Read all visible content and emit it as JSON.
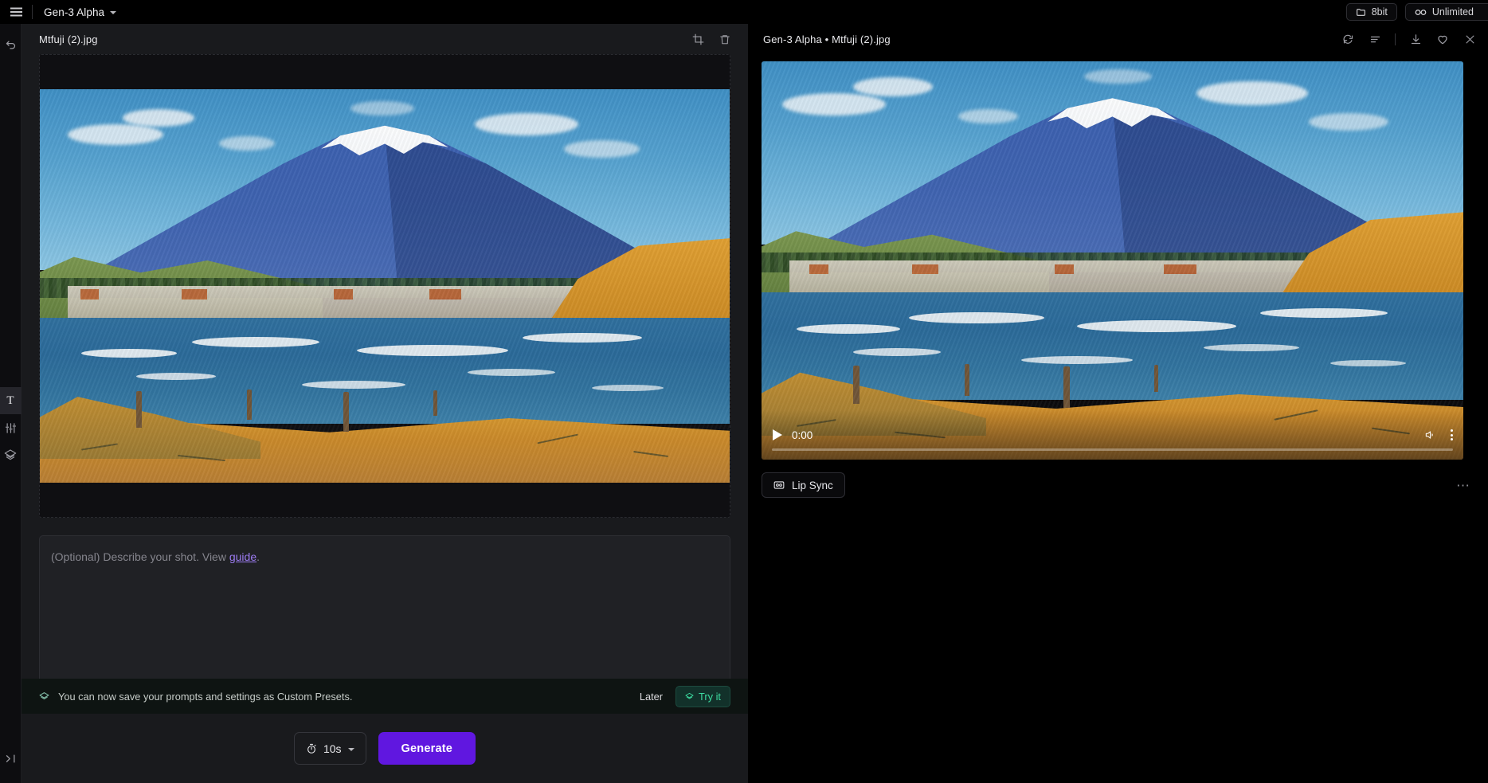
{
  "topbar": {
    "menu_icon": "hamburger-icon",
    "model_name": "Gen-3 Alpha",
    "chevron_icon": "chevron-down-icon",
    "folder_badge": {
      "icon": "folder-icon",
      "label": "8bit"
    },
    "plan_badge": {
      "icon": "infinity-icon",
      "label": "Unlimited"
    }
  },
  "rail": {
    "undo_icon": "undo-icon",
    "items": [
      {
        "name": "text-tool",
        "glyph": "T",
        "active": true
      },
      {
        "name": "settings-tool",
        "icon": "sliders-icon",
        "active": false
      },
      {
        "name": "layers-tool",
        "icon": "layers-icon",
        "active": false
      }
    ],
    "collapse_icon": "collapse-panel-icon"
  },
  "left_panel": {
    "title": "Mtfuji (2).jpg",
    "actions": [
      {
        "name": "crop-button",
        "icon": "crop-icon"
      },
      {
        "name": "delete-button",
        "icon": "trash-icon"
      }
    ],
    "prompt": {
      "placeholder_prefix": "(Optional) Describe your shot. View ",
      "placeholder_link": "guide",
      "placeholder_suffix": ".",
      "value": ""
    },
    "banner": {
      "icon": "layers-icon",
      "text": "You can now save your prompts and settings as Custom Presets.",
      "dismiss_label": "Later",
      "action_label": "Try it",
      "action_icon": "layers-icon",
      "accent": "#3ddba0"
    },
    "bottom": {
      "duration_icon": "stopwatch-icon",
      "duration_value": "10s",
      "duration_chevron": "chevron-down-icon",
      "generate_label": "Generate",
      "generate_color": "#6017e0"
    }
  },
  "right_panel": {
    "title": "Gen-3 Alpha • Mtfuji (2).jpg",
    "actions": [
      {
        "name": "regenerate-button",
        "icon": "refresh-icon"
      },
      {
        "name": "details-button",
        "icon": "list-icon"
      },
      {
        "name": "download-button",
        "icon": "download-icon"
      },
      {
        "name": "favorite-button",
        "icon": "heart-icon"
      },
      {
        "name": "close-button",
        "icon": "close-icon"
      }
    ],
    "player": {
      "play_icon": "play-icon",
      "timestamp": "0:00",
      "menu_icon": "kebab-menu-icon",
      "progress_percent": 0
    },
    "lip_sync": {
      "icon": "lip-sync-icon",
      "label": "Lip Sync"
    },
    "overflow_label": "⋯"
  }
}
